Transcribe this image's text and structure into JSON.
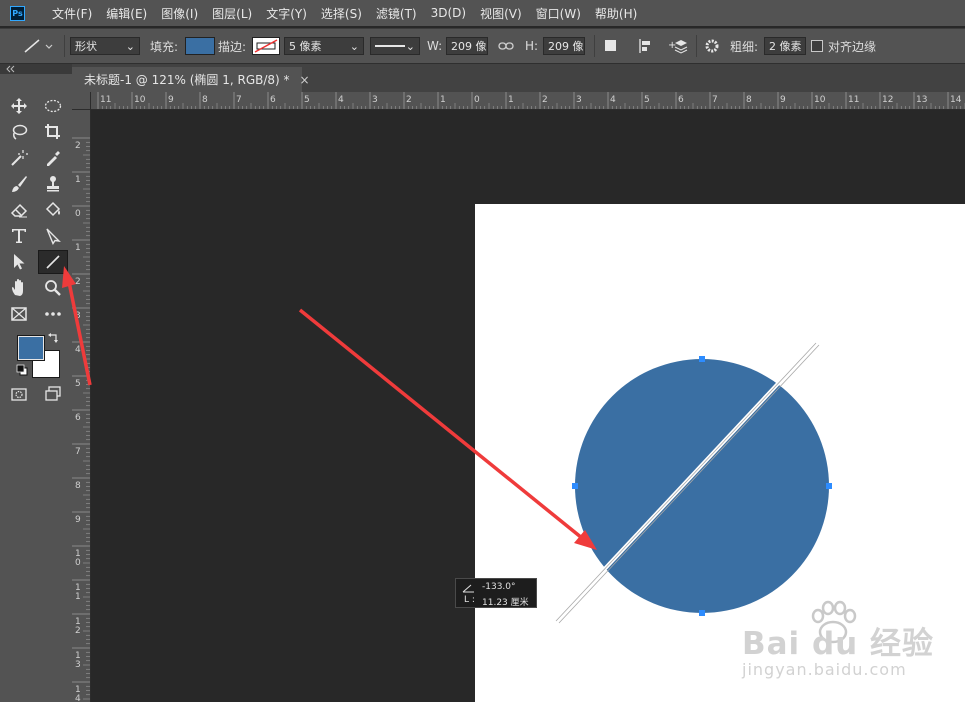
{
  "app": {
    "logo": "Ps"
  },
  "menubar": [
    "文件(F)",
    "编辑(E)",
    "图像(I)",
    "图层(L)",
    "文字(Y)",
    "选择(S)",
    "滤镜(T)",
    "3D(D)",
    "视图(V)",
    "窗口(W)",
    "帮助(H)"
  ],
  "options": {
    "shape_mode": "形状",
    "fill_label": "填充:",
    "fill_color": "#3a6fa3",
    "stroke_label": "描边:",
    "stroke_width": "5 像素",
    "w_label": "W:",
    "w_value": "209 像",
    "h_label": "H:",
    "h_value": "209 像",
    "weight_label": "粗细:",
    "weight_value": "2 像素",
    "align_edges_label": "对齐边缘",
    "align_edges_checked": false
  },
  "document_tab": {
    "title": "未标题-1 @ 121% (椭圆 1, RGB/8) *",
    "close": "×"
  },
  "ruler_top": [
    "11",
    "10",
    "9",
    "8",
    "7",
    "6",
    "5",
    "4",
    "3",
    "2",
    "1",
    "0",
    "1",
    "2",
    "3",
    "4",
    "5",
    "6",
    "7",
    "8",
    "9",
    "10",
    "11",
    "12",
    "13",
    "14"
  ],
  "ruler_left": [
    "2",
    "1",
    "0",
    "1",
    "2",
    "3",
    "4",
    "5",
    "6",
    "7",
    "8",
    "9",
    "1 0",
    "1 1",
    "1 2",
    "1 3",
    "1 4"
  ],
  "colors": {
    "foreground": "#3a6fa3",
    "background": "#ffffff",
    "ellipse": "#3a6fa3",
    "annotation_arrow": "#ef3b3b"
  },
  "readout": {
    "angle_value": "-133.0°",
    "length_label": "L :",
    "length_value": "11.23 厘米"
  },
  "watermark": {
    "brand": "Bai du 经验",
    "url": "jingyan.baidu.com"
  }
}
